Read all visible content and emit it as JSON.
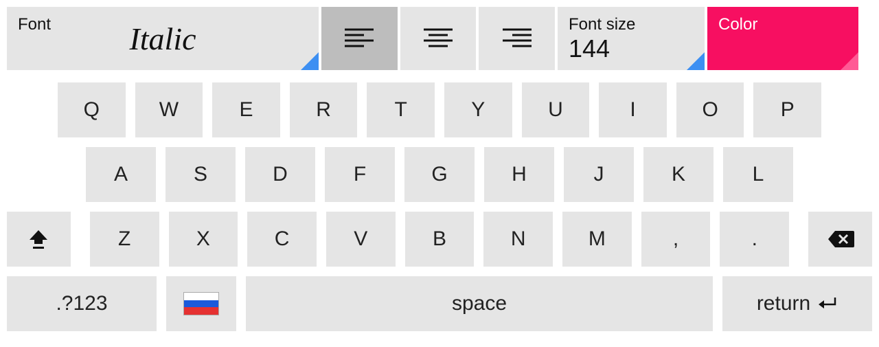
{
  "toolbar": {
    "font_label": "Font",
    "font_value": "Italic",
    "alignment": {
      "options": [
        "left",
        "center",
        "right"
      ],
      "selected": "left"
    },
    "fontsize_label": "Font size",
    "fontsize_value": "144",
    "color_label": "Color",
    "color_value": "#f70f61"
  },
  "keyboard": {
    "row1": [
      "Q",
      "W",
      "E",
      "R",
      "T",
      "Y",
      "U",
      "I",
      "O",
      "P"
    ],
    "row2": [
      "A",
      "S",
      "D",
      "F",
      "G",
      "H",
      "J",
      "K",
      "L"
    ],
    "row3": [
      "Z",
      "X",
      "C",
      "V",
      "B",
      "N",
      "M",
      ",",
      "."
    ],
    "symbols_key": ".?123",
    "language": "ru",
    "space_label": "space",
    "return_label": "return"
  }
}
